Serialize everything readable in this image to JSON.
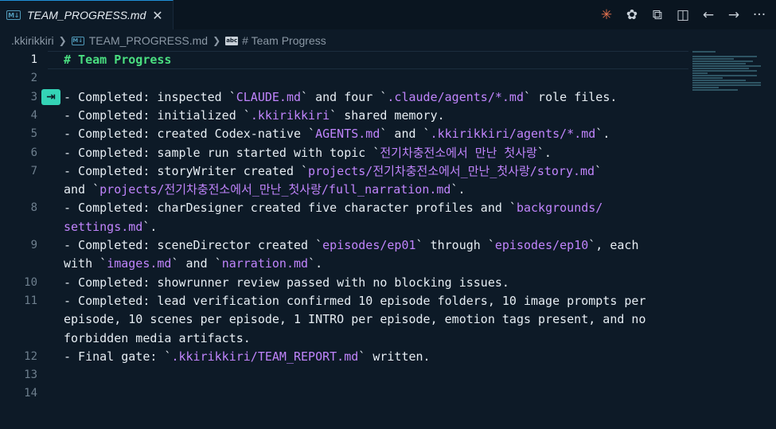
{
  "tab": {
    "icon": "markdown-icon",
    "title": "TEAM_PROGRESS.md",
    "close": "✕"
  },
  "toolbar": [
    {
      "name": "claude-icon",
      "glyph": "✳",
      "color": "#e8734f"
    },
    {
      "name": "openai-icon",
      "glyph": "✿",
      "color": "#c9d1d9"
    },
    {
      "name": "open-preview-icon",
      "glyph": "⧉",
      "color": "#c9d1d9"
    },
    {
      "name": "split-editor-icon",
      "glyph": "◫",
      "color": "#c9d1d9"
    },
    {
      "name": "go-back-icon",
      "glyph": "←",
      "color": "#c9d1d9"
    },
    {
      "name": "go-forward-icon",
      "glyph": "→",
      "color": "#c9d1d9"
    },
    {
      "name": "more-actions-icon",
      "glyph": "···",
      "color": "#c9d1d9"
    }
  ],
  "breadcrumb": {
    "folder": ".kkirikkiri",
    "file": "TEAM_PROGRESS.md",
    "symbol": "# Team Progress",
    "symbol_icon": "abc"
  },
  "tab_hint": "⇥",
  "editor": {
    "active_line": 1,
    "lines": [
      {
        "num": "1",
        "segments": [
          {
            "t": "# Team Progress",
            "c": "heading"
          }
        ]
      },
      {
        "num": "2",
        "segments": []
      },
      {
        "num": "3",
        "segments": [
          {
            "t": "- Completed: inspected `"
          },
          {
            "t": "CLAUDE.md",
            "c": "code"
          },
          {
            "t": "` and four `"
          },
          {
            "t": ".claude/agents/*.md",
            "c": "code"
          },
          {
            "t": "` role files."
          }
        ]
      },
      {
        "num": "4",
        "segments": [
          {
            "t": "- Completed: initialized `"
          },
          {
            "t": ".kkirikkiri",
            "c": "code"
          },
          {
            "t": "` shared memory."
          }
        ]
      },
      {
        "num": "5",
        "segments": [
          {
            "t": "- Completed: created Codex-native `"
          },
          {
            "t": "AGENTS.md",
            "c": "code"
          },
          {
            "t": "` and `"
          },
          {
            "t": ".kkirikkiri/agents/*.md",
            "c": "code"
          },
          {
            "t": "`."
          }
        ]
      },
      {
        "num": "6",
        "segments": [
          {
            "t": "- Completed: sample run started with topic `"
          },
          {
            "t": "전기차충전소에서 만난 첫사랑",
            "c": "code"
          },
          {
            "t": "`."
          }
        ]
      },
      {
        "num": "7",
        "segments": [
          {
            "t": "- Completed: storyWriter created `"
          },
          {
            "t": "projects/전기차충전소에서_만난_첫사랑/story.md",
            "c": "code"
          },
          {
            "t": "`"
          }
        ]
      },
      {
        "num": "",
        "segments": [
          {
            "t": "and `"
          },
          {
            "t": "projects/전기차충전소에서_만난_첫사랑/full_narration.md",
            "c": "code"
          },
          {
            "t": "`."
          }
        ]
      },
      {
        "num": "8",
        "segments": [
          {
            "t": "- Completed: charDesigner created five character profiles and `"
          },
          {
            "t": "backgrounds/",
            "c": "code"
          }
        ]
      },
      {
        "num": "",
        "segments": [
          {
            "t": "settings.md",
            "c": "code"
          },
          {
            "t": "`."
          }
        ]
      },
      {
        "num": "9",
        "segments": [
          {
            "t": "- Completed: sceneDirector created `"
          },
          {
            "t": "episodes/ep01",
            "c": "code"
          },
          {
            "t": "` through `"
          },
          {
            "t": "episodes/ep10",
            "c": "code"
          },
          {
            "t": "`, each"
          }
        ]
      },
      {
        "num": "",
        "segments": [
          {
            "t": "with `"
          },
          {
            "t": "images.md",
            "c": "code"
          },
          {
            "t": "` and `"
          },
          {
            "t": "narration.md",
            "c": "code"
          },
          {
            "t": "`."
          }
        ]
      },
      {
        "num": "10",
        "segments": [
          {
            "t": "- Completed: showrunner review passed with no blocking issues."
          }
        ]
      },
      {
        "num": "11",
        "segments": [
          {
            "t": "- Completed: lead verification confirmed 10 episode folders, 10 image prompts per"
          }
        ]
      },
      {
        "num": "",
        "segments": [
          {
            "t": "episode, 10 scenes per episode, 1 INTRO per episode, emotion tags present, and no"
          }
        ]
      },
      {
        "num": "",
        "segments": [
          {
            "t": "forbidden media artifacts."
          }
        ]
      },
      {
        "num": "12",
        "segments": [
          {
            "t": "- Final gate: `"
          },
          {
            "t": ".kkirikkiri/TEAM_REPORT.md",
            "c": "code"
          },
          {
            "t": "` written."
          }
        ]
      },
      {
        "num": "13",
        "segments": []
      },
      {
        "num": "14",
        "segments": []
      }
    ]
  }
}
